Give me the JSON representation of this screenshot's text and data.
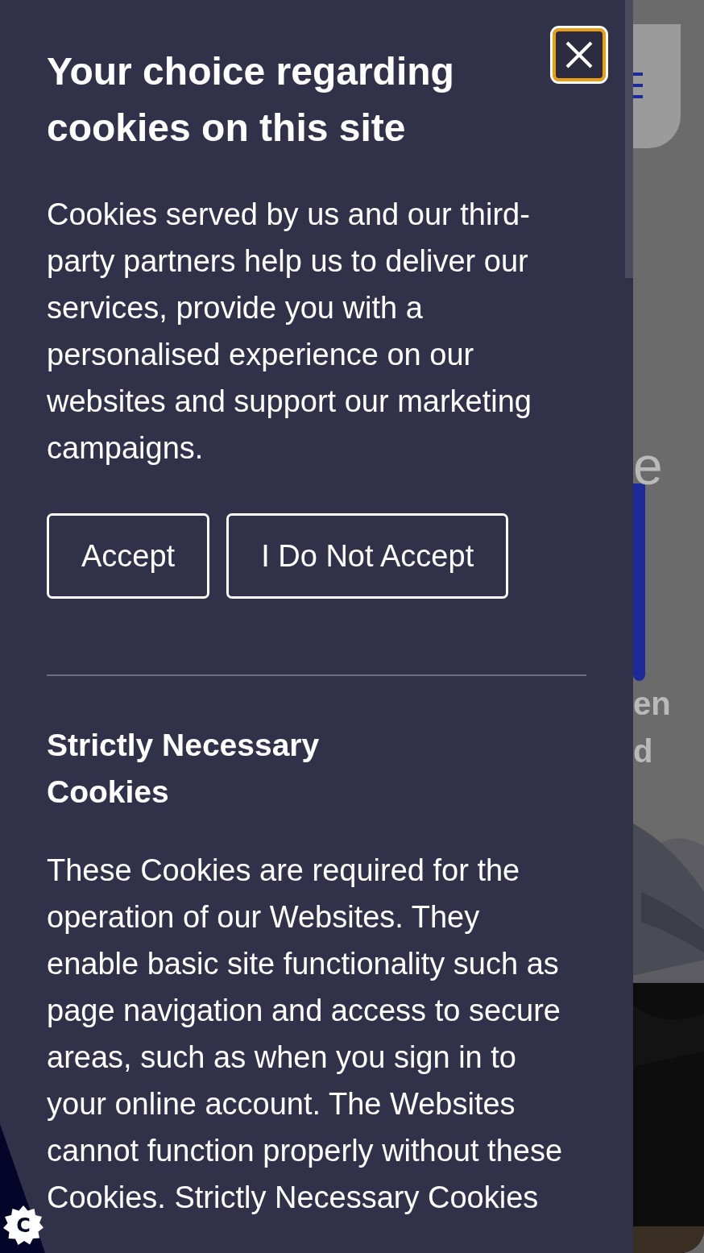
{
  "dialog": {
    "title": "Your choice regarding cookies on this site",
    "intro": "Cookies served by us and our third-party partners help us to deliver our services, provide you with a personalised experience on our websites and support our marketing campaigns.",
    "buttons": [
      {
        "label": "Accept"
      },
      {
        "label": "I Do Not Accept"
      }
    ],
    "sections": [
      {
        "heading": "Strictly Necessary Cookies",
        "text": "These Cookies are required for the operation of our Websites. They enable basic site functionality such as page navigation and access to secure areas, such as when you sign in to your online account. The Websites cannot function properly without these Cookies. Strictly Necessary Cookies"
      }
    ]
  },
  "background_page": {
    "texts": [
      "e",
      "en",
      "d"
    ]
  },
  "cookie_settings_badge": {
    "label": "C"
  }
}
